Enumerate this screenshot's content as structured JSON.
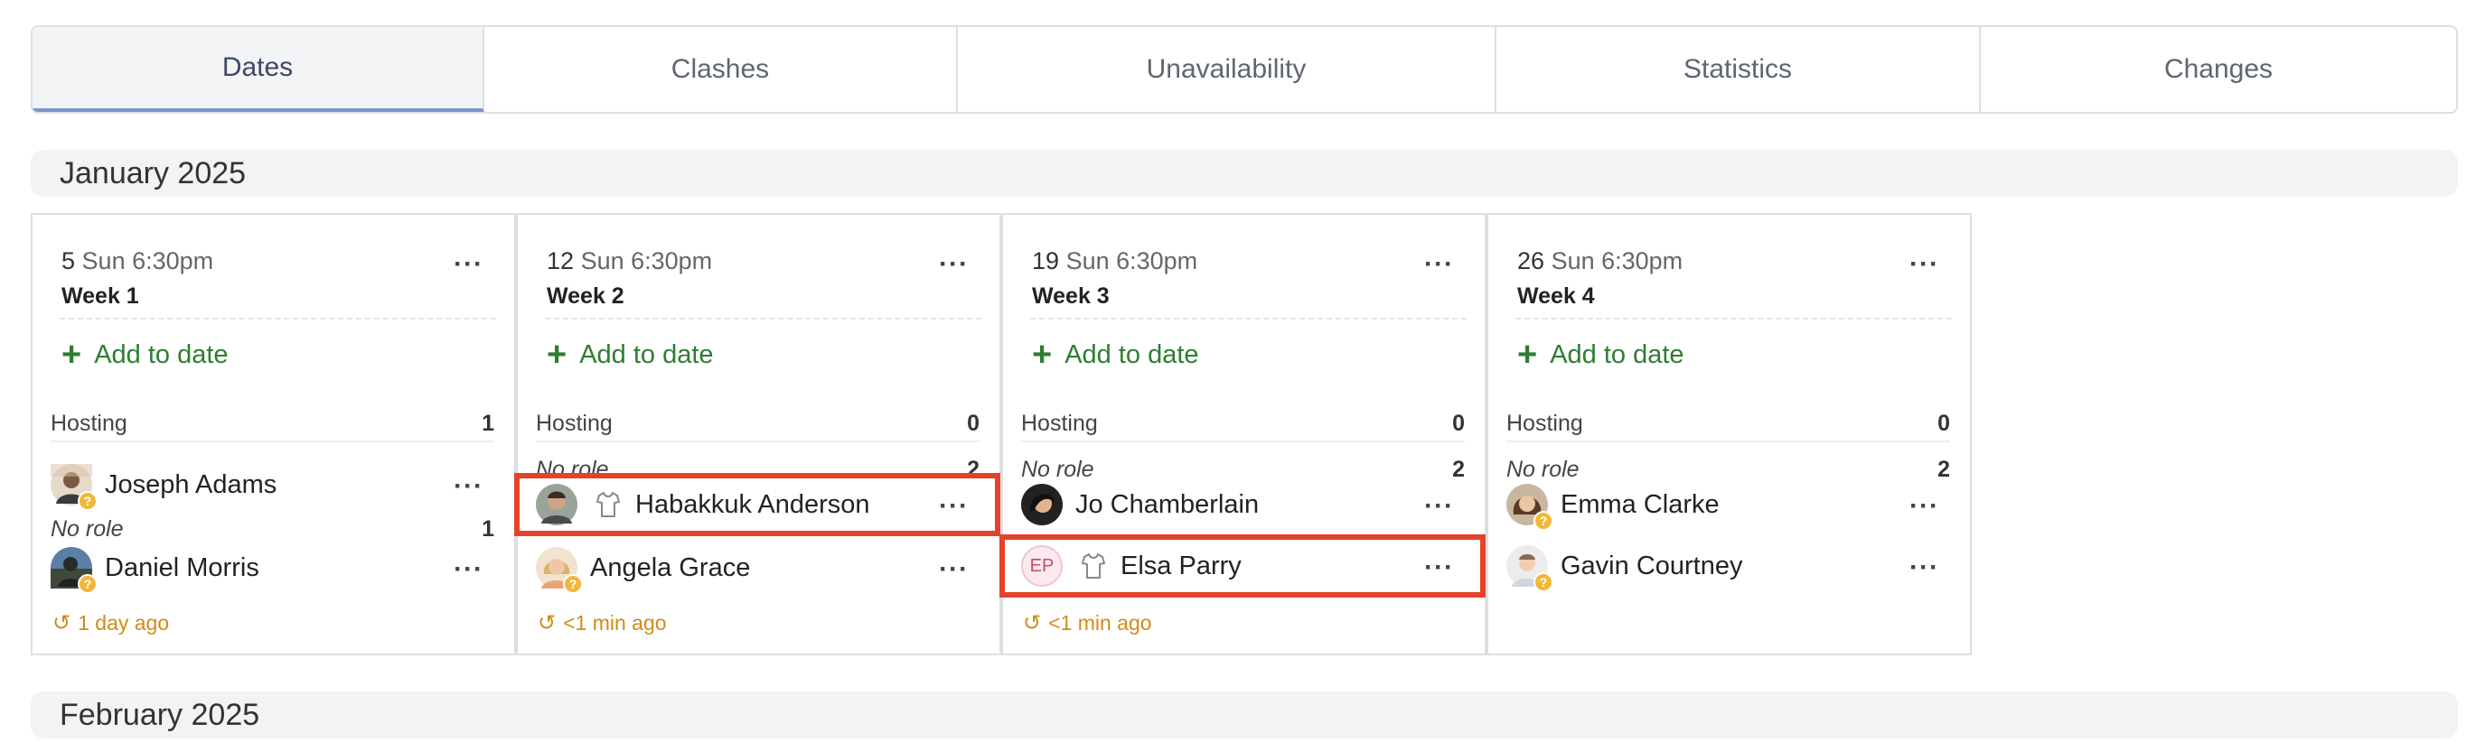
{
  "tabs": [
    {
      "label": "Dates",
      "active": true
    },
    {
      "label": "Clashes",
      "active": false
    },
    {
      "label": "Unavailability",
      "active": false
    },
    {
      "label": "Statistics",
      "active": false
    },
    {
      "label": "Changes",
      "active": false
    }
  ],
  "months": {
    "jan": "January 2025",
    "feb": "February 2025"
  },
  "common": {
    "add_label": "Add to date",
    "more": "···",
    "hosting": "Hosting",
    "no_role": "No role"
  },
  "cards": [
    {
      "day": "5",
      "time": "Sun 6:30pm",
      "week": "Week 1",
      "hosting_count": "1",
      "no_role_count": "1",
      "hosting_people": [
        {
          "name": "Joseph Adams",
          "avatar": "photo-avatar"
        }
      ],
      "no_role_people": [
        {
          "name": "Daniel Morris",
          "avatar": "photo-avatar"
        }
      ],
      "updated": "1 day ago"
    },
    {
      "day": "12",
      "time": "Sun 6:30pm",
      "week": "Week 2",
      "hosting_count": "0",
      "no_role_count": "2",
      "no_role_people": [
        {
          "name": "Habakkuk Anderson",
          "avatar": "photo-avatar",
          "shirt_icon": true,
          "highlighted": true
        },
        {
          "name": "Angela Grace",
          "avatar": "photo-avatar"
        }
      ],
      "updated": "<1 min ago"
    },
    {
      "day": "19",
      "time": "Sun 6:30pm",
      "week": "Week 3",
      "hosting_count": "0",
      "no_role_count": "2",
      "no_role_people": [
        {
          "name": "Jo Chamberlain",
          "avatar": "photo-avatar"
        },
        {
          "name": "Elsa Parry",
          "initials": "EP",
          "shirt_icon": true,
          "highlighted": true
        }
      ],
      "updated": "<1 min ago"
    },
    {
      "day": "26",
      "time": "Sun 6:30pm",
      "week": "Week 4",
      "hosting_count": "0",
      "no_role_count": "2",
      "no_role_people": [
        {
          "name": "Emma Clarke",
          "avatar": "photo-avatar"
        },
        {
          "name": "Gavin Courtney",
          "avatar": "photo-avatar"
        }
      ]
    }
  ],
  "colors": {
    "add_green": "#2e7d32",
    "highlight_red": "#e2432a",
    "history_orange": "#d48a18",
    "unconfirmed_badge": "#f2b73a"
  }
}
